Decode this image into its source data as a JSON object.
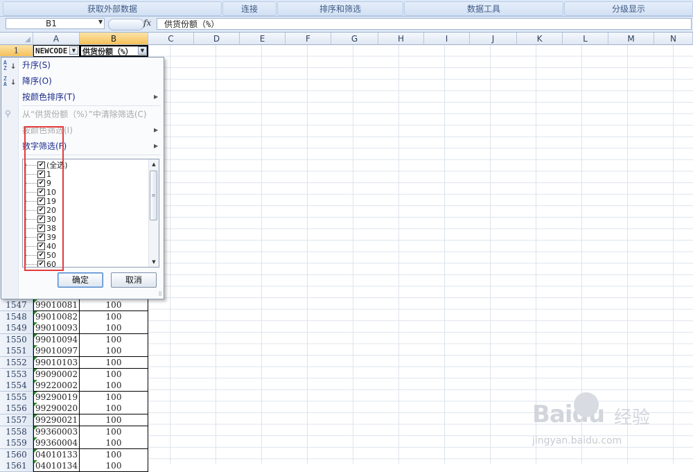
{
  "ribbon": {
    "groups": [
      "获取外部数据",
      "连接",
      "排序和筛选",
      "数据工具",
      "分级显示"
    ]
  },
  "formula_bar": {
    "name_box": "B1",
    "fx": "fx",
    "content": "供货份额（%）"
  },
  "columns": [
    "A",
    "B",
    "C",
    "D",
    "E",
    "F",
    "G",
    "H",
    "I",
    "J",
    "K",
    "L",
    "M",
    "N"
  ],
  "header_row": {
    "row_number": "1",
    "a": "NEWCODE",
    "b": "供货份额（%）"
  },
  "rows": [
    {
      "n": "1547",
      "a": "99010081",
      "b": "100"
    },
    {
      "n": "1548",
      "a": "99010082",
      "b": "100"
    },
    {
      "n": "1549",
      "a": "99010093",
      "b": "100"
    },
    {
      "n": "1550",
      "a": "99010094",
      "b": "100"
    },
    {
      "n": "1551",
      "a": "99010097",
      "b": "100"
    },
    {
      "n": "1552",
      "a": "99010103",
      "b": "100"
    },
    {
      "n": "1553",
      "a": "99090002",
      "b": "100"
    },
    {
      "n": "1554",
      "a": "99220002",
      "b": "100"
    },
    {
      "n": "1555",
      "a": "99290019",
      "b": "100"
    },
    {
      "n": "1556",
      "a": "99290020",
      "b": "100"
    },
    {
      "n": "1557",
      "a": "99290021",
      "b": "100"
    },
    {
      "n": "1558",
      "a": "99360003",
      "b": "100"
    },
    {
      "n": "1559",
      "a": "99360004",
      "b": "100"
    },
    {
      "n": "1560",
      "a": "04010133",
      "b": "100"
    },
    {
      "n": "1561",
      "a": "04010134",
      "b": "100"
    }
  ],
  "filter_menu": {
    "sort_asc": "升序(S)",
    "sort_desc": "降序(O)",
    "sort_by_color": "按颜色排序(T)",
    "clear_filter": "从“供货份额（%）”中清除筛选(C)",
    "filter_by_color": "按颜色筛选(I)",
    "number_filter": "数字筛选(F)",
    "values": [
      "(全选)",
      "1",
      "9",
      "10",
      "19",
      "20",
      "30",
      "38",
      "39",
      "40",
      "50",
      "60"
    ],
    "ok": "确定",
    "cancel": "取消"
  },
  "watermark": {
    "brand": "Baidu",
    "cn": "经验",
    "url": "jingyan.baidu.com"
  },
  "colors": {
    "ribbon": "#dbe7f7",
    "selected_header": "#f6c15b",
    "highlight": "#e33a3a"
  }
}
